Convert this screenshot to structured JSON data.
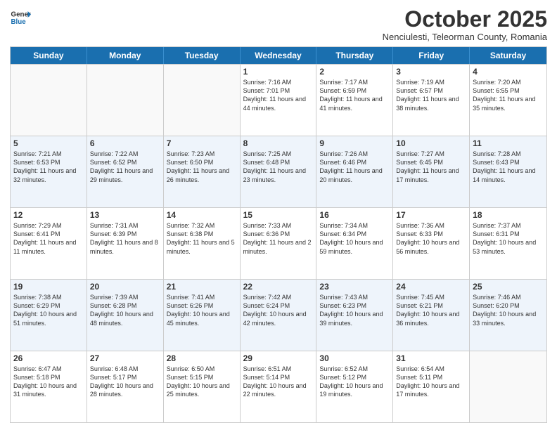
{
  "logo": {
    "general": "General",
    "blue": "Blue"
  },
  "header": {
    "month": "October 2025",
    "location": "Nenciulesti, Teleorman County, Romania"
  },
  "days_of_week": [
    "Sunday",
    "Monday",
    "Tuesday",
    "Wednesday",
    "Thursday",
    "Friday",
    "Saturday"
  ],
  "weeks": [
    [
      {
        "day": "",
        "sunrise": "",
        "sunset": "",
        "daylight": ""
      },
      {
        "day": "",
        "sunrise": "",
        "sunset": "",
        "daylight": ""
      },
      {
        "day": "",
        "sunrise": "",
        "sunset": "",
        "daylight": ""
      },
      {
        "day": "1",
        "sunrise": "Sunrise: 7:16 AM",
        "sunset": "Sunset: 7:01 PM",
        "daylight": "Daylight: 11 hours and 44 minutes."
      },
      {
        "day": "2",
        "sunrise": "Sunrise: 7:17 AM",
        "sunset": "Sunset: 6:59 PM",
        "daylight": "Daylight: 11 hours and 41 minutes."
      },
      {
        "day": "3",
        "sunrise": "Sunrise: 7:19 AM",
        "sunset": "Sunset: 6:57 PM",
        "daylight": "Daylight: 11 hours and 38 minutes."
      },
      {
        "day": "4",
        "sunrise": "Sunrise: 7:20 AM",
        "sunset": "Sunset: 6:55 PM",
        "daylight": "Daylight: 11 hours and 35 minutes."
      }
    ],
    [
      {
        "day": "5",
        "sunrise": "Sunrise: 7:21 AM",
        "sunset": "Sunset: 6:53 PM",
        "daylight": "Daylight: 11 hours and 32 minutes."
      },
      {
        "day": "6",
        "sunrise": "Sunrise: 7:22 AM",
        "sunset": "Sunset: 6:52 PM",
        "daylight": "Daylight: 11 hours and 29 minutes."
      },
      {
        "day": "7",
        "sunrise": "Sunrise: 7:23 AM",
        "sunset": "Sunset: 6:50 PM",
        "daylight": "Daylight: 11 hours and 26 minutes."
      },
      {
        "day": "8",
        "sunrise": "Sunrise: 7:25 AM",
        "sunset": "Sunset: 6:48 PM",
        "daylight": "Daylight: 11 hours and 23 minutes."
      },
      {
        "day": "9",
        "sunrise": "Sunrise: 7:26 AM",
        "sunset": "Sunset: 6:46 PM",
        "daylight": "Daylight: 11 hours and 20 minutes."
      },
      {
        "day": "10",
        "sunrise": "Sunrise: 7:27 AM",
        "sunset": "Sunset: 6:45 PM",
        "daylight": "Daylight: 11 hours and 17 minutes."
      },
      {
        "day": "11",
        "sunrise": "Sunrise: 7:28 AM",
        "sunset": "Sunset: 6:43 PM",
        "daylight": "Daylight: 11 hours and 14 minutes."
      }
    ],
    [
      {
        "day": "12",
        "sunrise": "Sunrise: 7:29 AM",
        "sunset": "Sunset: 6:41 PM",
        "daylight": "Daylight: 11 hours and 11 minutes."
      },
      {
        "day": "13",
        "sunrise": "Sunrise: 7:31 AM",
        "sunset": "Sunset: 6:39 PM",
        "daylight": "Daylight: 11 hours and 8 minutes."
      },
      {
        "day": "14",
        "sunrise": "Sunrise: 7:32 AM",
        "sunset": "Sunset: 6:38 PM",
        "daylight": "Daylight: 11 hours and 5 minutes."
      },
      {
        "day": "15",
        "sunrise": "Sunrise: 7:33 AM",
        "sunset": "Sunset: 6:36 PM",
        "daylight": "Daylight: 11 hours and 2 minutes."
      },
      {
        "day": "16",
        "sunrise": "Sunrise: 7:34 AM",
        "sunset": "Sunset: 6:34 PM",
        "daylight": "Daylight: 10 hours and 59 minutes."
      },
      {
        "day": "17",
        "sunrise": "Sunrise: 7:36 AM",
        "sunset": "Sunset: 6:33 PM",
        "daylight": "Daylight: 10 hours and 56 minutes."
      },
      {
        "day": "18",
        "sunrise": "Sunrise: 7:37 AM",
        "sunset": "Sunset: 6:31 PM",
        "daylight": "Daylight: 10 hours and 53 minutes."
      }
    ],
    [
      {
        "day": "19",
        "sunrise": "Sunrise: 7:38 AM",
        "sunset": "Sunset: 6:29 PM",
        "daylight": "Daylight: 10 hours and 51 minutes."
      },
      {
        "day": "20",
        "sunrise": "Sunrise: 7:39 AM",
        "sunset": "Sunset: 6:28 PM",
        "daylight": "Daylight: 10 hours and 48 minutes."
      },
      {
        "day": "21",
        "sunrise": "Sunrise: 7:41 AM",
        "sunset": "Sunset: 6:26 PM",
        "daylight": "Daylight: 10 hours and 45 minutes."
      },
      {
        "day": "22",
        "sunrise": "Sunrise: 7:42 AM",
        "sunset": "Sunset: 6:24 PM",
        "daylight": "Daylight: 10 hours and 42 minutes."
      },
      {
        "day": "23",
        "sunrise": "Sunrise: 7:43 AM",
        "sunset": "Sunset: 6:23 PM",
        "daylight": "Daylight: 10 hours and 39 minutes."
      },
      {
        "day": "24",
        "sunrise": "Sunrise: 7:45 AM",
        "sunset": "Sunset: 6:21 PM",
        "daylight": "Daylight: 10 hours and 36 minutes."
      },
      {
        "day": "25",
        "sunrise": "Sunrise: 7:46 AM",
        "sunset": "Sunset: 6:20 PM",
        "daylight": "Daylight: 10 hours and 33 minutes."
      }
    ],
    [
      {
        "day": "26",
        "sunrise": "Sunrise: 6:47 AM",
        "sunset": "Sunset: 5:18 PM",
        "daylight": "Daylight: 10 hours and 31 minutes."
      },
      {
        "day": "27",
        "sunrise": "Sunrise: 6:48 AM",
        "sunset": "Sunset: 5:17 PM",
        "daylight": "Daylight: 10 hours and 28 minutes."
      },
      {
        "day": "28",
        "sunrise": "Sunrise: 6:50 AM",
        "sunset": "Sunset: 5:15 PM",
        "daylight": "Daylight: 10 hours and 25 minutes."
      },
      {
        "day": "29",
        "sunrise": "Sunrise: 6:51 AM",
        "sunset": "Sunset: 5:14 PM",
        "daylight": "Daylight: 10 hours and 22 minutes."
      },
      {
        "day": "30",
        "sunrise": "Sunrise: 6:52 AM",
        "sunset": "Sunset: 5:12 PM",
        "daylight": "Daylight: 10 hours and 19 minutes."
      },
      {
        "day": "31",
        "sunrise": "Sunrise: 6:54 AM",
        "sunset": "Sunset: 5:11 PM",
        "daylight": "Daylight: 10 hours and 17 minutes."
      },
      {
        "day": "",
        "sunrise": "",
        "sunset": "",
        "daylight": ""
      }
    ]
  ]
}
